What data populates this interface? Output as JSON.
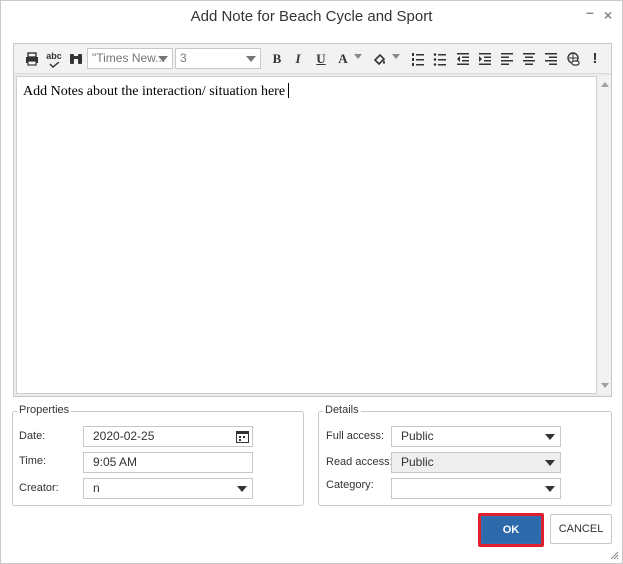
{
  "dialog": {
    "title": "Add Note for Beach Cycle and Sport",
    "minimize_glyph": "–",
    "close_glyph": "×"
  },
  "toolbar": {
    "font_family": "\"Times New...",
    "font_size": "3",
    "tools": [
      "print-icon",
      "spellcheck-icon",
      "find-icon",
      "bold-icon",
      "italic-icon",
      "underline-icon",
      "font-color-icon",
      "highlight-icon",
      "numbered-list-icon",
      "bulleted-list-icon",
      "outdent-icon",
      "indent-icon",
      "align-left-icon",
      "align-center-icon",
      "align-right-icon",
      "link-icon",
      "important-icon"
    ],
    "bold_glyph": "B",
    "italic_glyph": "I",
    "underline_glyph": "U",
    "font_color_glyph": "A",
    "important_glyph": "!",
    "spell_glyph": "abc"
  },
  "editor": {
    "content": "Add Notes about the interaction/ situation here"
  },
  "properties": {
    "legend": "Properties",
    "date_label": "Date:",
    "date_value": "2020-02-25",
    "time_label": "Time:",
    "time_value": "9:05 AM",
    "creator_label": "Creator:",
    "creator_value": "n"
  },
  "details": {
    "legend": "Details",
    "full_access_label": "Full access:",
    "full_access_value": "Public",
    "read_access_label": "Read access:",
    "read_access_value": "Public",
    "category_label": "Category:",
    "category_value": ""
  },
  "buttons": {
    "ok": "OK",
    "cancel": "CANCEL"
  }
}
